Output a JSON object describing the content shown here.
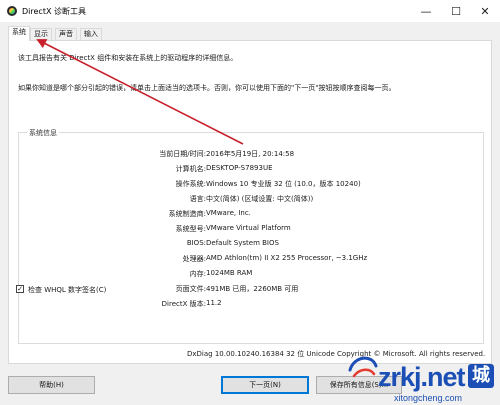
{
  "window": {
    "title": "DirectX 诊断工具",
    "minimize_label": "—",
    "maximize_label": "☐",
    "close_label": "✕"
  },
  "tabs": [
    "系统",
    "显示",
    "声音",
    "输入"
  ],
  "intro_line1": "该工具报告有关 DirectX 组件和安装在系统上的驱动程序的详细信息。",
  "intro_line2": "如果你知道是哪个部分引起的错误，请单击上面适当的选项卡。否则，你可以使用下面的\"下一页\"按钮按顺序查阅每一页。",
  "system_info": {
    "legend": "系统信息",
    "rows": [
      {
        "label": "当前日期/时间:",
        "value": "2016年5月19日, 20:14:58"
      },
      {
        "label": "计算机名:",
        "value": "DESKTOP-S7893UE"
      },
      {
        "label": "操作系统:",
        "value": "Windows 10 专业版 32 位 (10.0，版本 10240)"
      },
      {
        "label": "语言:",
        "value": "中文(简体) (区域设置: 中文(简体))"
      },
      {
        "label": "系统制造商:",
        "value": "VMware, Inc."
      },
      {
        "label": "系统型号:",
        "value": "VMware Virtual Platform"
      },
      {
        "label": "BIOS:",
        "value": "Default System BIOS"
      },
      {
        "label": "处理器:",
        "value": "AMD Athlon(tm) II X2 255 Processor, ~3.1GHz"
      },
      {
        "label": "内存:",
        "value": "1024MB RAM"
      },
      {
        "label": "页面文件:",
        "value": "491MB 已用，2260MB 可用"
      },
      {
        "label": "DirectX 版本:",
        "value": "11.2"
      }
    ]
  },
  "whql": {
    "label": "检查 WHQL 数字签名(C)",
    "checked": true,
    "check_mark": "✓"
  },
  "version_line": "DxDiag 10.00.10240.16384 32 位 Unicode  Copyright © Microsoft. All rights reserved.",
  "buttons": {
    "help": "帮助(H)",
    "next": "下一页(N)",
    "save": "保存所有信息(S)..."
  },
  "watermark": {
    "logo": "zrkj.net",
    "cn_badge": "城",
    "sub": "xitongcheng.com"
  },
  "colors": {
    "accent": "#0078d7",
    "arrow": "#c8202a",
    "watermark": "#1b4fb5"
  }
}
